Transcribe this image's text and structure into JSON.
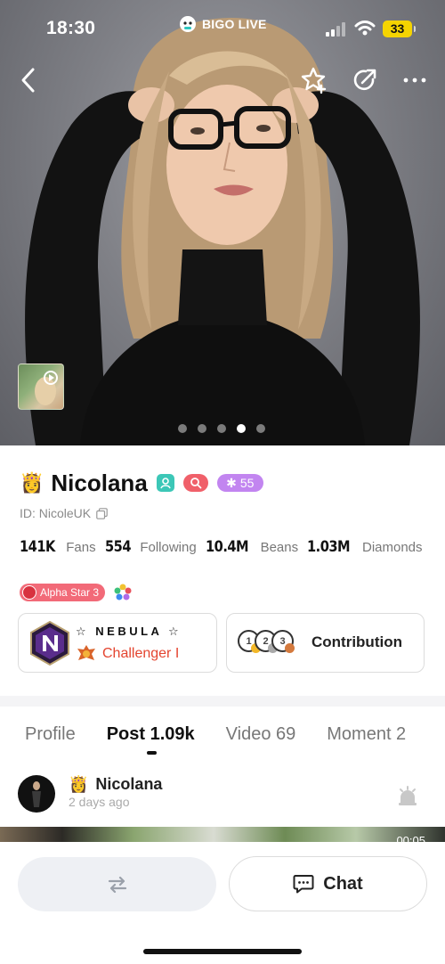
{
  "status_bar": {
    "time": "18:30",
    "brand": "BIGO LIVE",
    "battery": "33",
    "battery_color": "#f5d400"
  },
  "nav": {
    "icons": [
      "back-icon",
      "favorite-star-icon",
      "share-icon",
      "more-icon"
    ]
  },
  "gallery": {
    "page_count": 5,
    "active_page": 4
  },
  "profile": {
    "crown": "👸",
    "name": "Nicolana",
    "level": "55",
    "id_text": "ID: NicoleUK",
    "stats": [
      {
        "value": "141K",
        "label": "Fans"
      },
      {
        "value": "554",
        "label": "Following"
      },
      {
        "value": "10.4M",
        "label": "Beans"
      },
      {
        "value": "1.03M",
        "label": "Diamonds"
      }
    ],
    "alpha_label": "Alpha Star 3"
  },
  "rank_card": {
    "title": "☆ NEBULA ☆",
    "tier": "Challenger I",
    "tier_color": "#e4442f"
  },
  "contribution_card": {
    "medals": [
      "1",
      "2",
      "3"
    ],
    "label": "Contribution"
  },
  "tabs": [
    {
      "label": "Profile"
    },
    {
      "label": "Post 1.09k",
      "active": true
    },
    {
      "label": "Video 69"
    },
    {
      "label": "Moment 2"
    }
  ],
  "post": {
    "author_crown": "👸",
    "author": "Nicolana",
    "time": "2 days ago",
    "duration": "00:05"
  },
  "bottom_bar": {
    "chat_label": "Chat"
  }
}
